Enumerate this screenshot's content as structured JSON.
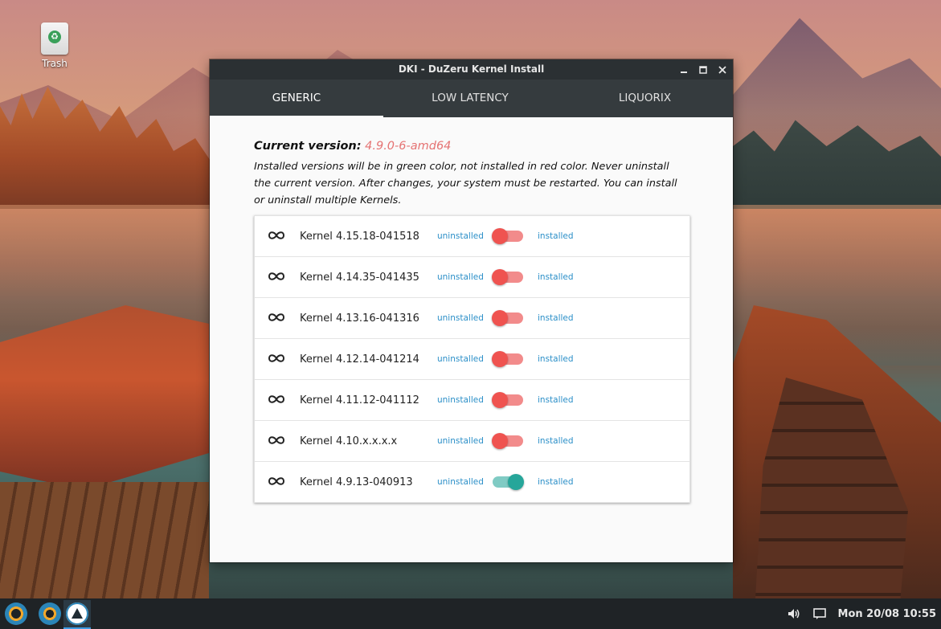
{
  "desktop": {
    "icons": [
      {
        "label": "Trash",
        "icon": "trash-icon"
      }
    ]
  },
  "window": {
    "title": "DKI - DuZeru Kernel Install",
    "controls": {
      "minimize": "minimize-icon",
      "maximize": "maximize-icon",
      "close": "close-icon"
    },
    "tabs": [
      {
        "label": "GENERIC",
        "active": true
      },
      {
        "label": "LOW LATENCY",
        "active": false
      },
      {
        "label": "LIQUORIX",
        "active": false
      }
    ],
    "current_label": "Current version:",
    "current_value": "4.9.0-6-amd64",
    "description": "Installed versions will be in green color, not installed in red color. Never uninstall the current version. After changes, your system must be restarted. You can install or uninstall multiple Kernels.",
    "kernels": [
      {
        "name": "Kernel 4.15.18-041518",
        "left": "uninstalled",
        "right": "installed",
        "installed": false
      },
      {
        "name": "Kernel 4.14.35-041435",
        "left": "uninstalled",
        "right": "installed",
        "installed": false
      },
      {
        "name": "Kernel 4.13.16-041316",
        "left": "uninstalled",
        "right": "installed",
        "installed": false
      },
      {
        "name": "Kernel 4.12.14-041214",
        "left": "uninstalled",
        "right": "installed",
        "installed": false
      },
      {
        "name": "Kernel 4.11.12-041112",
        "left": "uninstalled",
        "right": "installed",
        "installed": false
      },
      {
        "name": "Kernel 4.10.x.x.x.x",
        "left": "uninstalled",
        "right": "installed",
        "installed": false
      },
      {
        "name": "Kernel 4.9.13-040913",
        "left": "uninstalled",
        "right": "installed",
        "installed": true
      }
    ],
    "colors": {
      "installed": "#26a69a",
      "uninstalled": "#ef5350",
      "accent_link": "#2b8fc8"
    }
  },
  "taskbar": {
    "datetime": "Mon 20/08 10:55",
    "icons": [
      "menu-icon",
      "app-icon",
      "dki-app-icon",
      "volume-icon",
      "message-icon"
    ]
  }
}
